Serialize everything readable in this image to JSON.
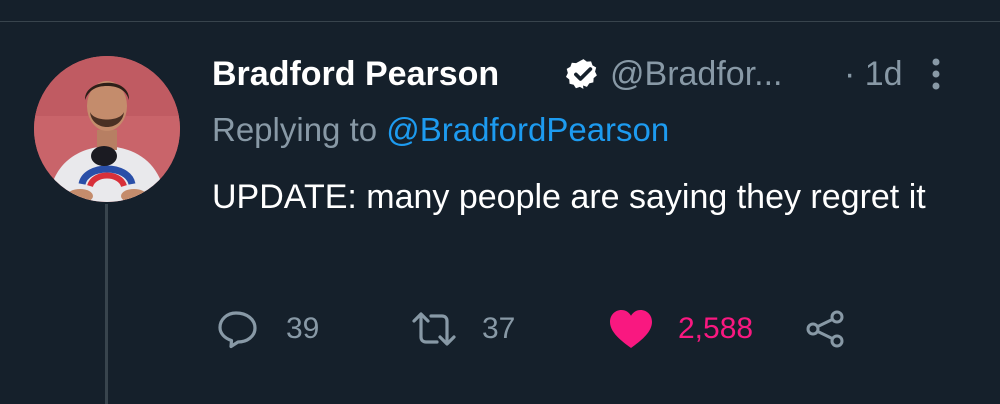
{
  "tweet": {
    "author_name": "Bradford Pearson",
    "author_handle": "@Bradfor...",
    "time_ago": "· 1d",
    "replying_prefix": "Replying to ",
    "replying_to": "@BradfordPearson",
    "text": "UPDATE: many people are saying they regret it"
  },
  "actions": {
    "reply_count": "39",
    "retweet_count": "37",
    "like_count": "2,588",
    "liked": true
  },
  "icons": [
    "verified-badge-icon",
    "more-options-icon",
    "reply-icon",
    "retweet-icon",
    "heart-icon",
    "share-icon"
  ],
  "colors": {
    "background": "#15202b",
    "primary_text": "#ffffff",
    "secondary_text": "#8899a6",
    "link": "#1d9bf0",
    "like": "#f91880",
    "divider": "#38444d"
  }
}
